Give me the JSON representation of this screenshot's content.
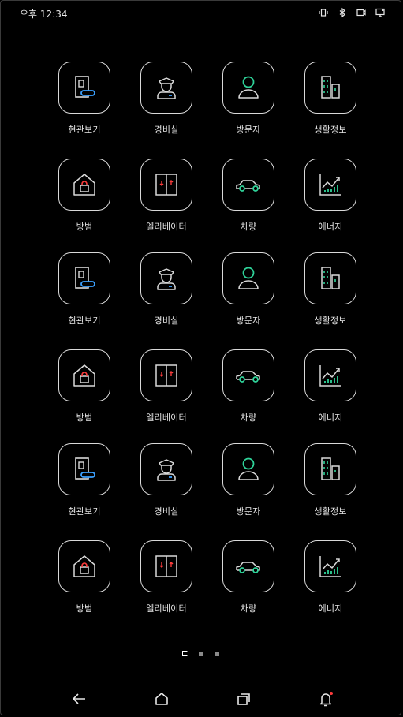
{
  "status_bar": {
    "time": "오후 12:34",
    "icons": [
      "vibrate-icon",
      "bluetooth-icon",
      "cast-icon",
      "monitor-icon"
    ]
  },
  "colors": {
    "background": "#000000",
    "outline": "#d9d9d9",
    "accent_green": "#2fd49a",
    "accent_blue": "#3aa0ff",
    "accent_red": "#ff3b3b",
    "notification_dot": "#ff3b3b"
  },
  "apps": [
    {
      "label": "현관보기",
      "icon": "door-viewer-icon"
    },
    {
      "label": "경비실",
      "icon": "security-guard-icon"
    },
    {
      "label": "방문자",
      "icon": "visitor-icon"
    },
    {
      "label": "생활정보",
      "icon": "buildings-icon"
    },
    {
      "label": "방범",
      "icon": "house-lock-icon"
    },
    {
      "label": "엘리베이터",
      "icon": "elevator-icon"
    },
    {
      "label": "차량",
      "icon": "car-icon"
    },
    {
      "label": "에너지",
      "icon": "energy-chart-icon"
    },
    {
      "label": "현관보기",
      "icon": "door-viewer-icon"
    },
    {
      "label": "경비실",
      "icon": "security-guard-icon"
    },
    {
      "label": "방문자",
      "icon": "visitor-icon"
    },
    {
      "label": "생활정보",
      "icon": "buildings-icon"
    },
    {
      "label": "방범",
      "icon": "house-lock-icon"
    },
    {
      "label": "엘리베이터",
      "icon": "elevator-icon"
    },
    {
      "label": "차량",
      "icon": "car-icon"
    },
    {
      "label": "에너지",
      "icon": "energy-chart-icon"
    },
    {
      "label": "현관보기",
      "icon": "door-viewer-icon"
    },
    {
      "label": "경비실",
      "icon": "security-guard-icon"
    },
    {
      "label": "방문자",
      "icon": "visitor-icon"
    },
    {
      "label": "생활정보",
      "icon": "buildings-icon"
    },
    {
      "label": "방범",
      "icon": "house-lock-icon"
    },
    {
      "label": "엘리베이터",
      "icon": "elevator-icon"
    },
    {
      "label": "차량",
      "icon": "car-icon"
    },
    {
      "label": "에너지",
      "icon": "energy-chart-icon"
    }
  ],
  "pager": {
    "pages": 3,
    "current": 1
  },
  "navbar": [
    "back-icon",
    "home-icon",
    "recents-icon",
    "notification-bell-icon"
  ]
}
